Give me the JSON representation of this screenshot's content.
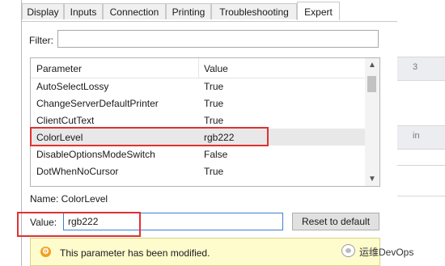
{
  "tabs": [
    {
      "label": "Display"
    },
    {
      "label": "Inputs"
    },
    {
      "label": "Connection"
    },
    {
      "label": "Printing"
    },
    {
      "label": "Troubleshooting"
    },
    {
      "label": "Expert",
      "active": true
    }
  ],
  "filter": {
    "label": "Filter:",
    "value": ""
  },
  "list": {
    "headers": {
      "parameter": "Parameter",
      "value": "Value"
    },
    "rows": [
      {
        "parameter": "AutoSelectLossy",
        "value": "True"
      },
      {
        "parameter": "ChangeServerDefaultPrinter",
        "value": "True"
      },
      {
        "parameter": "ClientCutText",
        "value": "True"
      },
      {
        "parameter": "ColorLevel",
        "value": "rgb222",
        "selected": true
      },
      {
        "parameter": "DisableOptionsModeSwitch",
        "value": "False"
      },
      {
        "parameter": "DotWhenNoCursor",
        "value": "True"
      }
    ]
  },
  "name_line": "Name: ColorLevel",
  "value_field": {
    "label": "Value:",
    "value": "rgb222"
  },
  "reset_button": "Reset to default",
  "notice": {
    "text": "This parameter has been modified."
  },
  "background": {
    "strip1_text": "3",
    "strip2_text": "in"
  },
  "watermark": {
    "text": "运维DevOps"
  },
  "colors": {
    "highlight_border": "#e03131",
    "notice_bg": "#fefbcd",
    "input_focus": "#3c7fd1"
  }
}
